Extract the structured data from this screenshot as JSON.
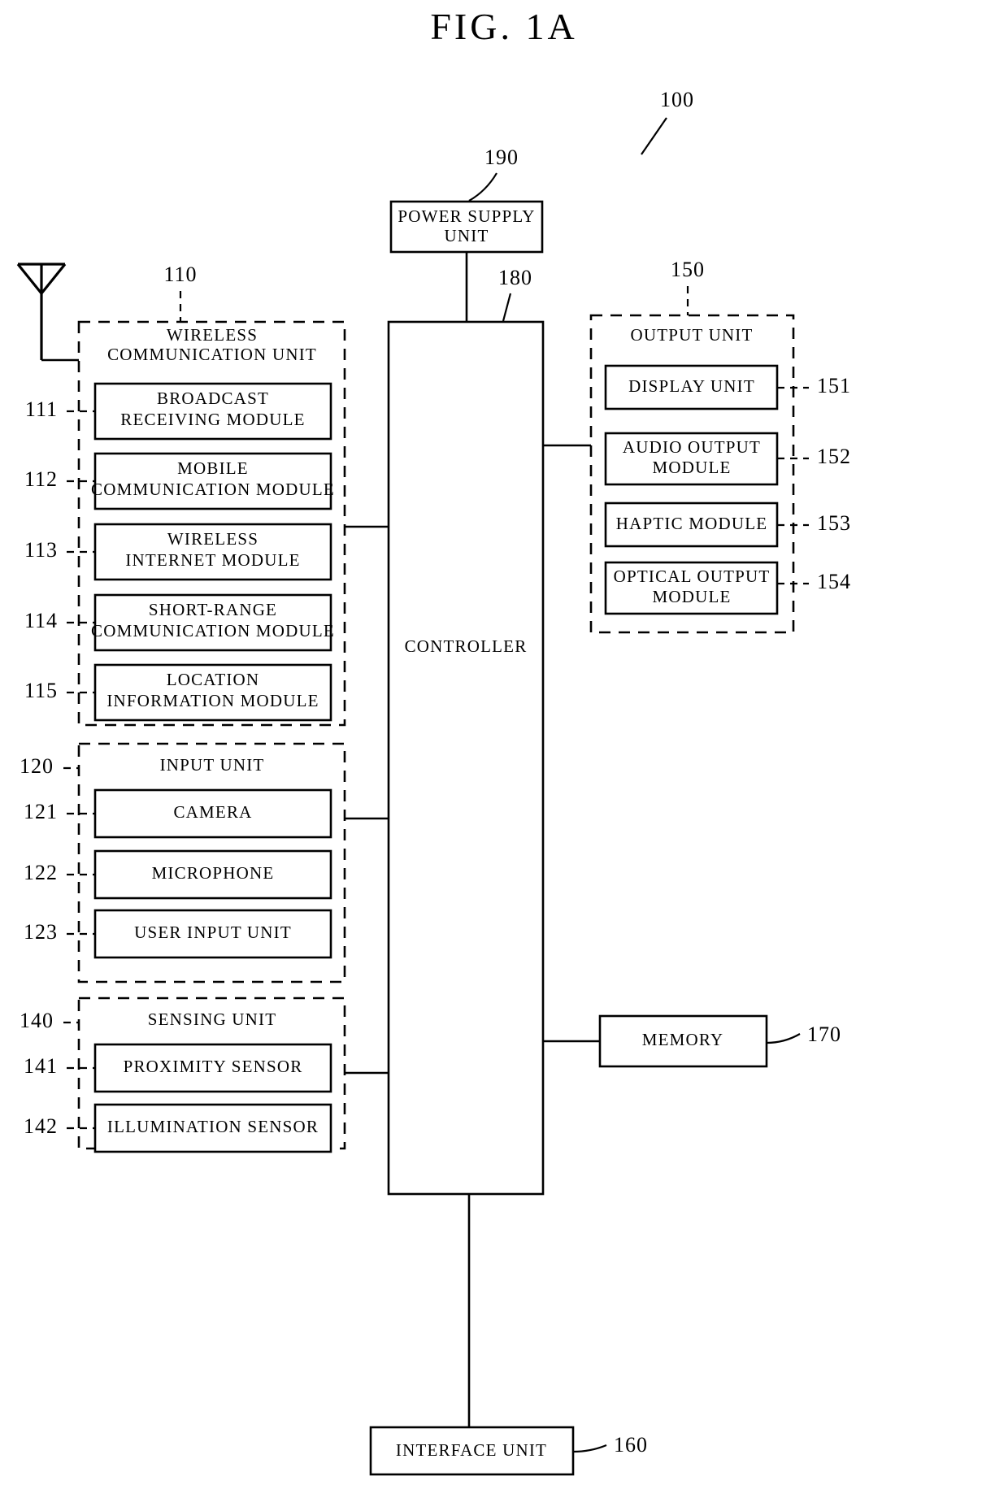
{
  "figure": {
    "title": "FIG.  1A",
    "device_ref": "100"
  },
  "power_supply": {
    "label_line1": "POWER SUPPLY",
    "label_line2": "UNIT",
    "ref": "190"
  },
  "controller": {
    "label": "CONTROLLER",
    "ref": "180"
  },
  "wireless_communication_unit": {
    "label_line1": "WIRELESS",
    "label_line2": "COMMUNICATION UNIT",
    "ref": "110",
    "modules": [
      {
        "ref": "111",
        "line1": "BROADCAST",
        "line2": "RECEIVING MODULE"
      },
      {
        "ref": "112",
        "line1": "MOBILE",
        "line2": "COMMUNICATION MODULE"
      },
      {
        "ref": "113",
        "line1": "WIRELESS",
        "line2": "INTERNET MODULE"
      },
      {
        "ref": "114",
        "line1": "SHORT-RANGE",
        "line2": "COMMUNICATION MODULE"
      },
      {
        "ref": "115",
        "line1": "LOCATION",
        "line2": "INFORMATION MODULE"
      }
    ]
  },
  "input_unit": {
    "label": "INPUT UNIT",
    "ref": "120",
    "modules": [
      {
        "ref": "121",
        "line1": "CAMERA",
        "line2": ""
      },
      {
        "ref": "122",
        "line1": "MICROPHONE",
        "line2": ""
      },
      {
        "ref": "123",
        "line1": "USER INPUT UNIT",
        "line2": ""
      }
    ]
  },
  "sensing_unit": {
    "label": "SENSING UNIT",
    "ref": "140",
    "modules": [
      {
        "ref": "141",
        "line1": "PROXIMITY SENSOR",
        "line2": ""
      },
      {
        "ref": "142",
        "line1": "ILLUMINATION SENSOR",
        "line2": ""
      }
    ]
  },
  "output_unit": {
    "label": "OUTPUT UNIT",
    "ref": "150",
    "modules": [
      {
        "ref": "151",
        "line1": "DISPLAY UNIT",
        "line2": ""
      },
      {
        "ref": "152",
        "line1": "AUDIO OUTPUT",
        "line2": "MODULE"
      },
      {
        "ref": "153",
        "line1": "HAPTIC MODULE",
        "line2": ""
      },
      {
        "ref": "154",
        "line1": "OPTICAL OUTPUT",
        "line2": "MODULE"
      }
    ]
  },
  "memory": {
    "label": "MEMORY",
    "ref": "170"
  },
  "interface_unit": {
    "label": "INTERFACE UNIT",
    "ref": "160"
  },
  "antenna": {
    "name": "antenna-symbol"
  }
}
